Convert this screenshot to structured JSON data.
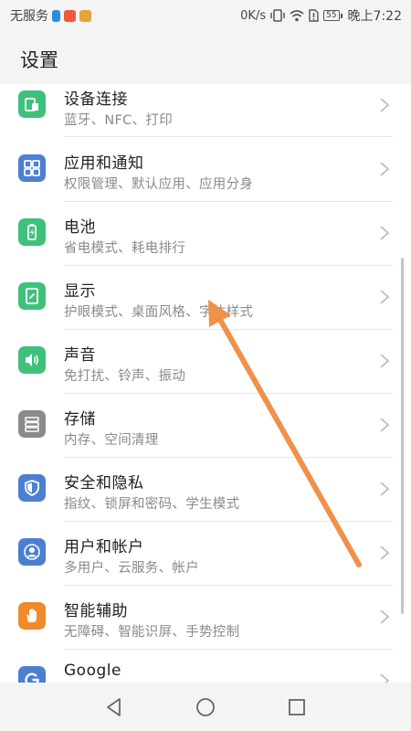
{
  "status_bar": {
    "carrier": "无服务",
    "net_speed": "0K/s",
    "battery": "55",
    "time": "晚上7:22"
  },
  "header": {
    "title": "设置"
  },
  "settings_items": [
    {
      "title": "设备连接",
      "subtitle": "蓝牙、NFC、打印",
      "icon": "device-connection-icon",
      "color": "#3fc17c"
    },
    {
      "title": "应用和通知",
      "subtitle": "权限管理、默认应用、应用分身",
      "icon": "apps-icon",
      "color": "#4c7fd0"
    },
    {
      "title": "电池",
      "subtitle": "省电模式、耗电排行",
      "icon": "battery-icon",
      "color": "#3fc17c"
    },
    {
      "title": "显示",
      "subtitle": "护眼模式、桌面风格、字体样式",
      "icon": "display-icon",
      "color": "#3fc17c"
    },
    {
      "title": "声音",
      "subtitle": "免打扰、铃声、振动",
      "icon": "sound-icon",
      "color": "#3fc17c"
    },
    {
      "title": "存储",
      "subtitle": "内存、空间清理",
      "icon": "storage-icon",
      "color": "#8a8a8a"
    },
    {
      "title": "安全和隐私",
      "subtitle": "指纹、锁屏和密码、学生模式",
      "icon": "shield-icon",
      "color": "#4c7fd0"
    },
    {
      "title": "用户和帐户",
      "subtitle": "多用户、云服务、帐户",
      "icon": "user-icon",
      "color": "#4c7fd0"
    },
    {
      "title": "智能辅助",
      "subtitle": "无障碍、智能识屏、手势控制",
      "icon": "hand-icon",
      "color": "#f08a2a"
    },
    {
      "title": "Google",
      "subtitle": "",
      "icon": "google-icon",
      "color": "#4c7fd0"
    }
  ],
  "annotation": {
    "arrow_color": "#f0914a"
  }
}
